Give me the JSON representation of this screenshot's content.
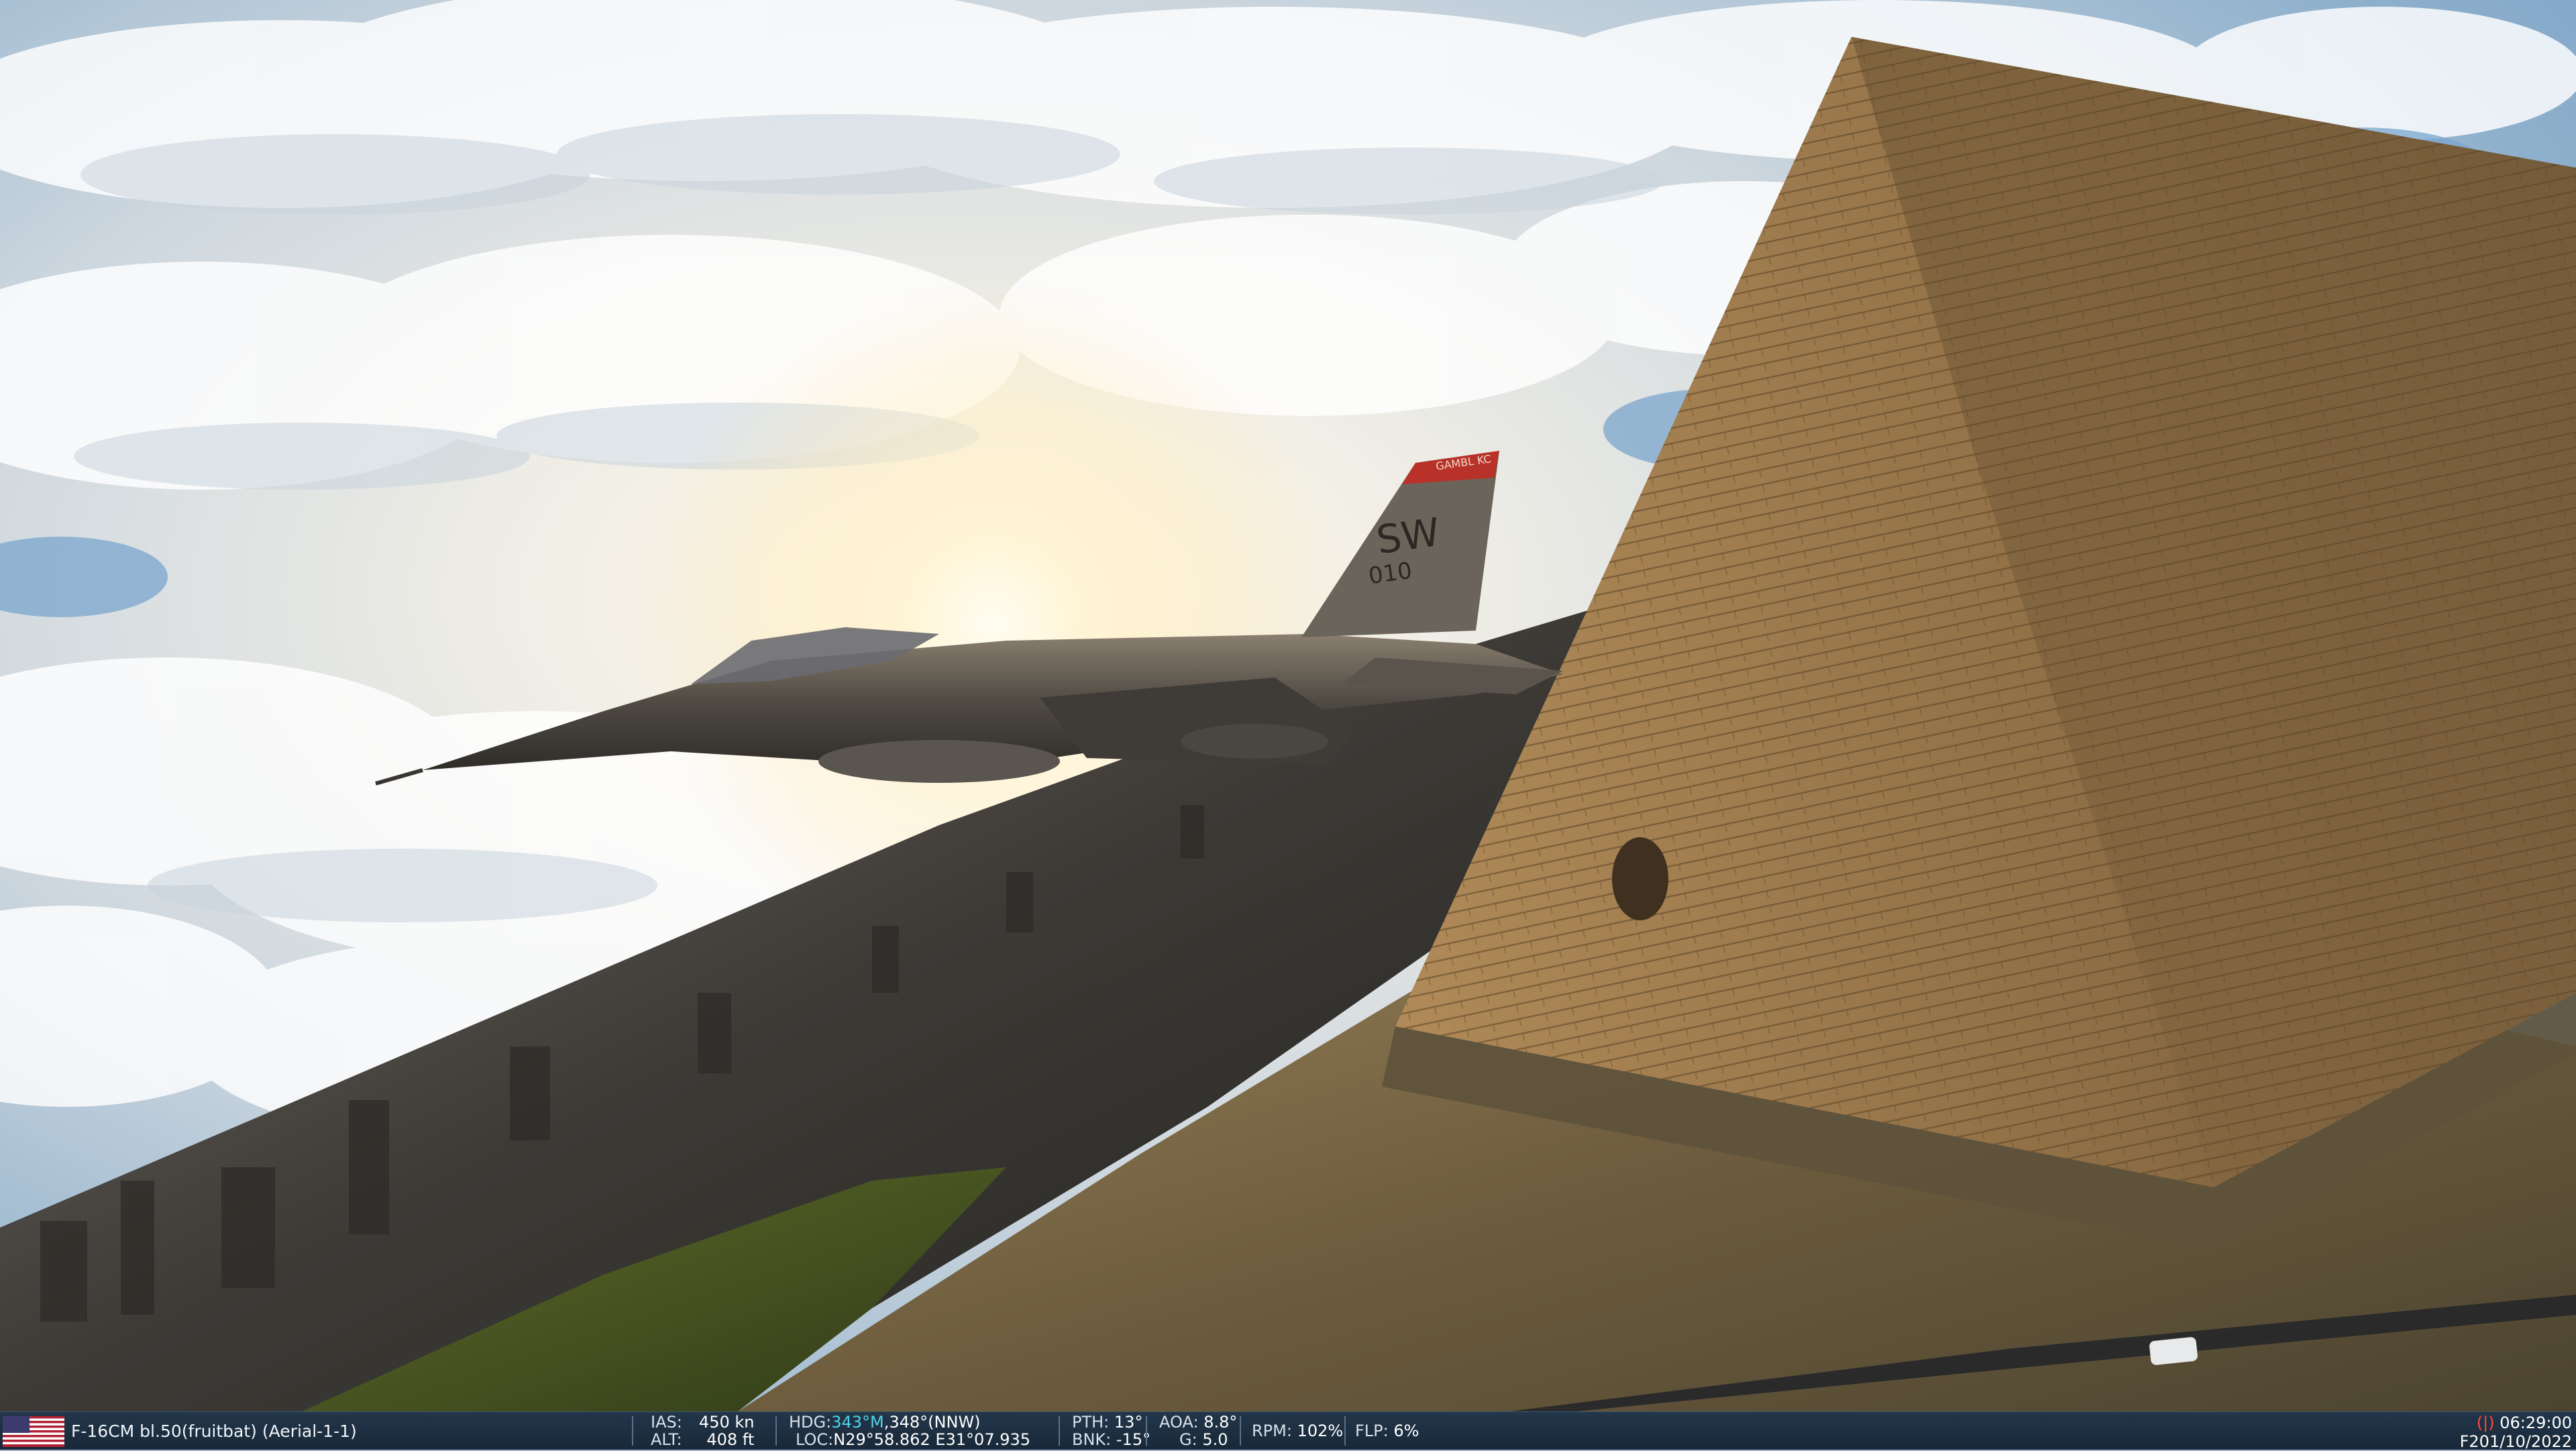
{
  "unit": {
    "name": "F-16CM bl.50(fruitbat) (Aerial-1-1)",
    "flag_icon": "usa-flag-icon"
  },
  "aircraft_markings": {
    "tail_code": "SW",
    "serial": "010",
    "tail_band": "GAMBL KC"
  },
  "hud": {
    "ias_label": "IAS:",
    "ias_value": "450 kn",
    "alt_label": "ALT:",
    "alt_value": "408 ft",
    "hdg_label": "HDG:",
    "hdg_magnetic": "343°M",
    "hdg_true": ",348°(NNW)",
    "loc_label": "LOC:",
    "loc_value": "N29°58.862 E31°07.935",
    "pth_label": "PTH:",
    "pth_value": "13°",
    "bnk_label": "BNK:",
    "bnk_value": "-15°",
    "aoa_label": "AOA:",
    "aoa_value": "8.8°",
    "g_label": "G:",
    "g_value": "5.0",
    "rpm_label": "RPM:",
    "rpm_value": "102%",
    "flp_label": "FLP:",
    "flp_value": "6%",
    "rec_indicator": "(|)",
    "time": "06:29:00",
    "date": "F201/10/2022"
  },
  "colors": {
    "bar_bg": "#1e3042",
    "accent_cyan": "#4fd4ea",
    "rec_red": "#ff4a3a",
    "tail_band_red": "#b8322a"
  }
}
